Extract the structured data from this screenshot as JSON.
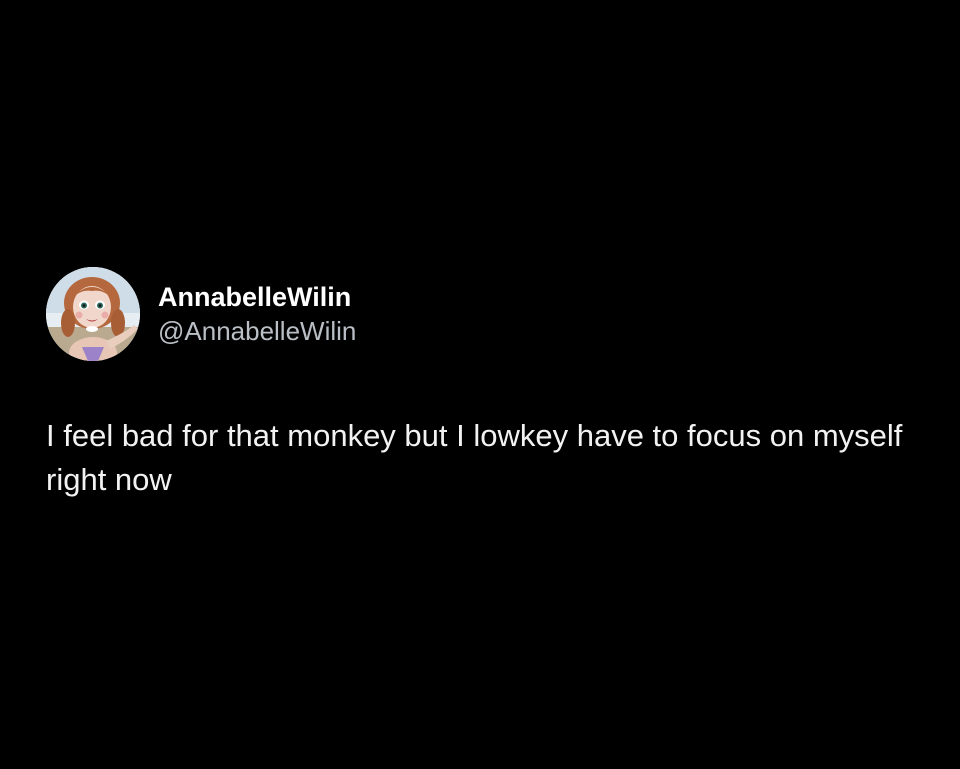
{
  "tweet": {
    "author": {
      "display_name": "AnnabelleWilin",
      "handle": "@AnnabelleWilin",
      "avatar_icon": "doll-avatar"
    },
    "text": "I feel bad for that monkey but I lowkey have to focus on myself right now"
  },
  "colors": {
    "background": "#000000",
    "text_primary": "#ffffff",
    "text_secondary": "#b9bfc4"
  }
}
